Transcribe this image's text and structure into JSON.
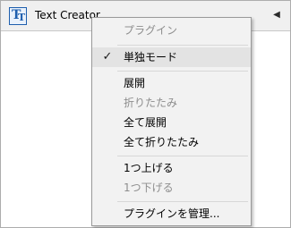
{
  "panel": {
    "title": "Text Creator",
    "icon": "text-creator-plugin-icon",
    "collapse_icon": "collapse-triangle-icon",
    "collapse_glyph": "◀"
  },
  "menu": {
    "items": [
      {
        "label": "プラグイン",
        "enabled": false,
        "checked": false
      },
      {
        "label": "単独モード",
        "enabled": true,
        "checked": true
      },
      {
        "label": "展開",
        "enabled": true,
        "checked": false
      },
      {
        "label": "折りたたみ",
        "enabled": false,
        "checked": false
      },
      {
        "label": "全て展開",
        "enabled": true,
        "checked": false
      },
      {
        "label": "全て折りたたみ",
        "enabled": true,
        "checked": false
      },
      {
        "label": "1つ上げる",
        "enabled": true,
        "checked": false
      },
      {
        "label": "1つ下げる",
        "enabled": false,
        "checked": false
      },
      {
        "label": "プラグインを管理...",
        "enabled": true,
        "checked": false
      }
    ],
    "check_glyph": "✓"
  }
}
